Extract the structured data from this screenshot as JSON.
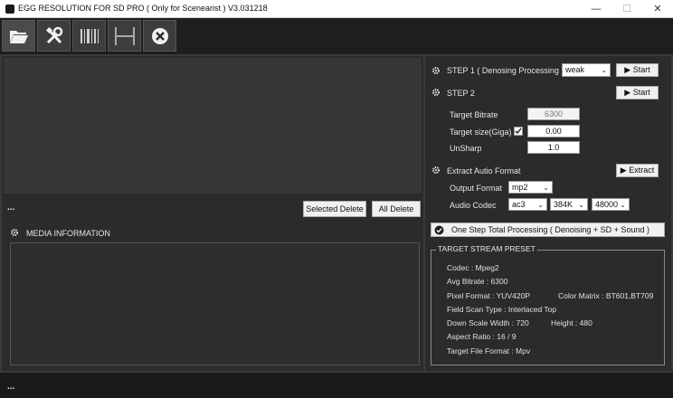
{
  "window": {
    "title": "EGG RESOLUTION FOR SD PRO ( Only for Scenearist ) V3.031218",
    "minimize": "—",
    "maximize": "☐",
    "close": "✕"
  },
  "toolbar": {
    "items": [
      {
        "icon": "folder-open-icon"
      },
      {
        "icon": "tools-icon"
      },
      {
        "icon": "barcode-icon"
      },
      {
        "icon": "resize-width-icon"
      },
      {
        "icon": "close-circle-icon"
      }
    ]
  },
  "left": {
    "file_label": "...",
    "selected_delete": "Selected Delete",
    "all_delete": "All Delete",
    "media_info_title": "MEDIA INFORMATION"
  },
  "step1": {
    "title": "STEP 1 ( Denosing Processing )",
    "mode": "weak",
    "start": "Start"
  },
  "step2": {
    "title": "STEP 2",
    "start": "Start",
    "target_bitrate_label": "Target Bitrate",
    "target_bitrate": "6300",
    "target_size_label": "Target size(Giga)",
    "target_size_checked": true,
    "target_size": "0.00",
    "unsharp_label": "UnSharp",
    "unsharp": "1.0"
  },
  "extract": {
    "title": "Extract Autio Format",
    "button": "Extract",
    "output_format_label": "Output Format",
    "output_format": "mp2",
    "audio_codec_label": "Audio Codec",
    "audio_codec": "ac3",
    "audio_bitrate": "384K",
    "sample_rate": "48000"
  },
  "one_step": {
    "label": "One Step Total Processing ( Denoising + SD + Sound )"
  },
  "preset": {
    "title": "TARGET STREAM PRESET",
    "codec": "Codec : Mpeg2",
    "avg_bitrate": "Avg Bitrate : 6300",
    "pixel_format": "Pixel Format : YUV420P",
    "color_matrix": "Color Matrix : BT601,BT709",
    "field_scan": "Field Scan Type : Interlaced Top",
    "down_scale_width": "Down Scale Width : 720",
    "height": "Height : 480",
    "aspect_ratio": "Aspect Ratio : 16 / 9",
    "file_format": "Target File Format : Mpv"
  },
  "status": {
    "text": "..."
  },
  "colors": {
    "background": "#3a3a3a",
    "panel": "#2b2b2b",
    "toolbar": "#1e1e1e"
  }
}
